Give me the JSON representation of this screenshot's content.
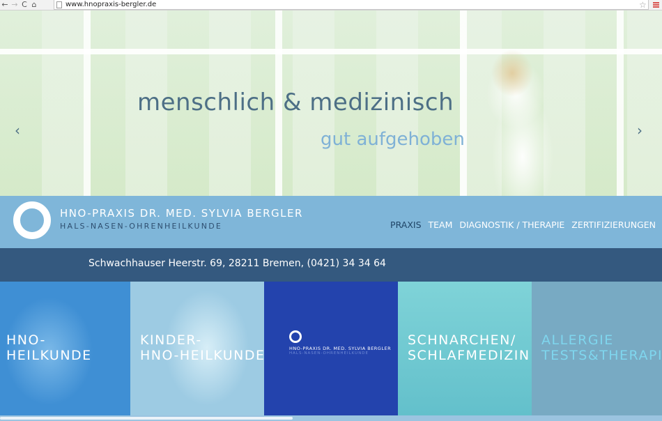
{
  "browser": {
    "url": "www.hnopraxis-bergler.de",
    "back_icon": "←",
    "forward_icon": "→",
    "reload_icon": "C",
    "home_icon": "⌂",
    "star_icon": "☆"
  },
  "hero": {
    "title": "menschlich & medizinisch",
    "subtitle": "gut aufgehoben",
    "prev": "‹",
    "next": "›"
  },
  "header": {
    "practice_name": "HNO-PRAXIS DR. MED. SYLVIA BERGLER",
    "practice_sub": "HALS-NASEN-OHRENHEILKUNDE",
    "nav": [
      "PRAXIS",
      "TEAM",
      "DIAGNOSTIK / THERAPIE",
      "ZERTIFIZIERUNGEN"
    ]
  },
  "address": "Schwachhauser Heerstr. 69, 28211 Bremen, (0421) 34 34 64",
  "tiles": {
    "hno": [
      "HNO-",
      "HEILKUNDE"
    ],
    "kinder": [
      "KINDER-",
      "HNO-HEILKUNDE"
    ],
    "logo": {
      "name": "HNO-PRAXIS DR. MED. SYLVIA BERGLER",
      "sub": "HALS-NASEN-OHRENHEILKUNDE"
    },
    "schnarchen": [
      "SCHNARCHEN/",
      "SCHLAFMEDIZIN"
    ],
    "allergie": [
      "ALLERGIE",
      "TESTS&THERAPIE"
    ]
  },
  "colors": {
    "header_band": "#7fb6d9",
    "address_band": "#34597f",
    "logo_tile": "#2343ad",
    "nav_active": "#1f4466"
  }
}
